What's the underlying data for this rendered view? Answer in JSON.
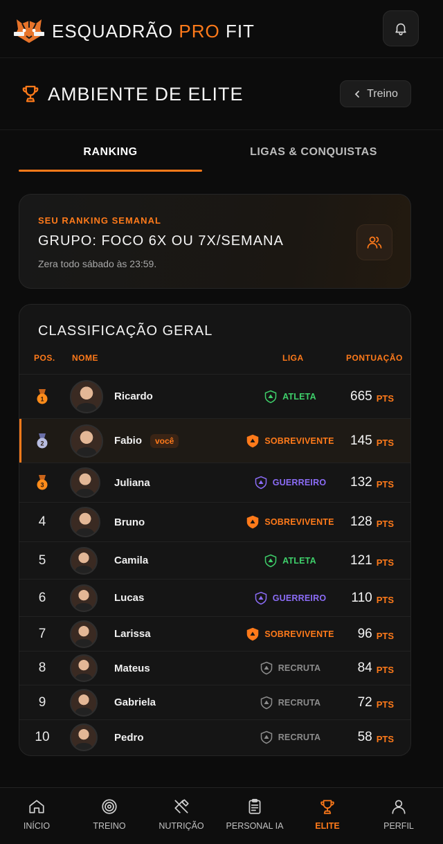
{
  "header": {
    "brand_part1": "ESQUADRÃO ",
    "brand_part2": "PRO",
    "brand_part3": " FIT",
    "bell_icon": "bell-icon"
  },
  "section": {
    "title": "AMBIENTE DE ELITE",
    "back_label": "Treino"
  },
  "tabs": [
    {
      "label": "RANKING",
      "active": true
    },
    {
      "label": "LIGAS & CONQUISTAS",
      "active": false
    }
  ],
  "weekly": {
    "label": "SEU RANKING SEMANAL",
    "group": "GRUPO: FOCO 6X OU 7X/SEMANA",
    "reset": "Zera todo sábado às 23:59."
  },
  "board": {
    "title": "CLASSIFICAÇÃO GERAL",
    "columns": {
      "pos": "POS.",
      "name": "NOME",
      "league": "LIGA",
      "points": "PONTUAÇÃO"
    },
    "points_unit": "PTS",
    "you_badge": "você",
    "rows": [
      {
        "pos": "1",
        "medal": "gold",
        "name": "Ricardo",
        "league": "ATLETA",
        "points": "665"
      },
      {
        "pos": "2",
        "medal": "silver",
        "name": "Fabio",
        "league": "SOBREVIVENTE",
        "points": "145",
        "me": true
      },
      {
        "pos": "3",
        "medal": "bronze",
        "name": "Juliana",
        "league": "GUERREIRO",
        "points": "132"
      },
      {
        "pos": "4",
        "name": "Bruno",
        "league": "SOBREVIVENTE",
        "points": "128"
      },
      {
        "pos": "5",
        "name": "Camila",
        "league": "ATLETA",
        "points": "121"
      },
      {
        "pos": "6",
        "name": "Lucas",
        "league": "GUERREIRO",
        "points": "110"
      },
      {
        "pos": "7",
        "name": "Larissa",
        "league": "SOBREVIVENTE",
        "points": "96"
      },
      {
        "pos": "8",
        "name": "Mateus",
        "league": "RECRUTA",
        "points": "84"
      },
      {
        "pos": "9",
        "name": "Gabriela",
        "league": "RECRUTA",
        "points": "72"
      },
      {
        "pos": "10",
        "name": "Pedro",
        "league": "RECRUTA",
        "points": "58"
      }
    ]
  },
  "league_colors": {
    "ATLETA": "#3ecf6a",
    "SOBREVIVENTE": "#ff7a1a",
    "GUERREIRO": "#8b6cf6",
    "RECRUTA": "#8c8c8c"
  },
  "nav": [
    {
      "label": "INÍCIO",
      "icon": "home-icon",
      "active": false
    },
    {
      "label": "TREINO",
      "icon": "target-icon",
      "active": false
    },
    {
      "label": "NUTRIÇÃO",
      "icon": "utensils-icon",
      "active": false
    },
    {
      "label": "PERSONAL IA",
      "icon": "clipboard-icon",
      "active": false
    },
    {
      "label": "ELITE",
      "icon": "trophy-icon",
      "active": true
    },
    {
      "label": "PERFIL",
      "icon": "user-icon",
      "active": false
    }
  ]
}
